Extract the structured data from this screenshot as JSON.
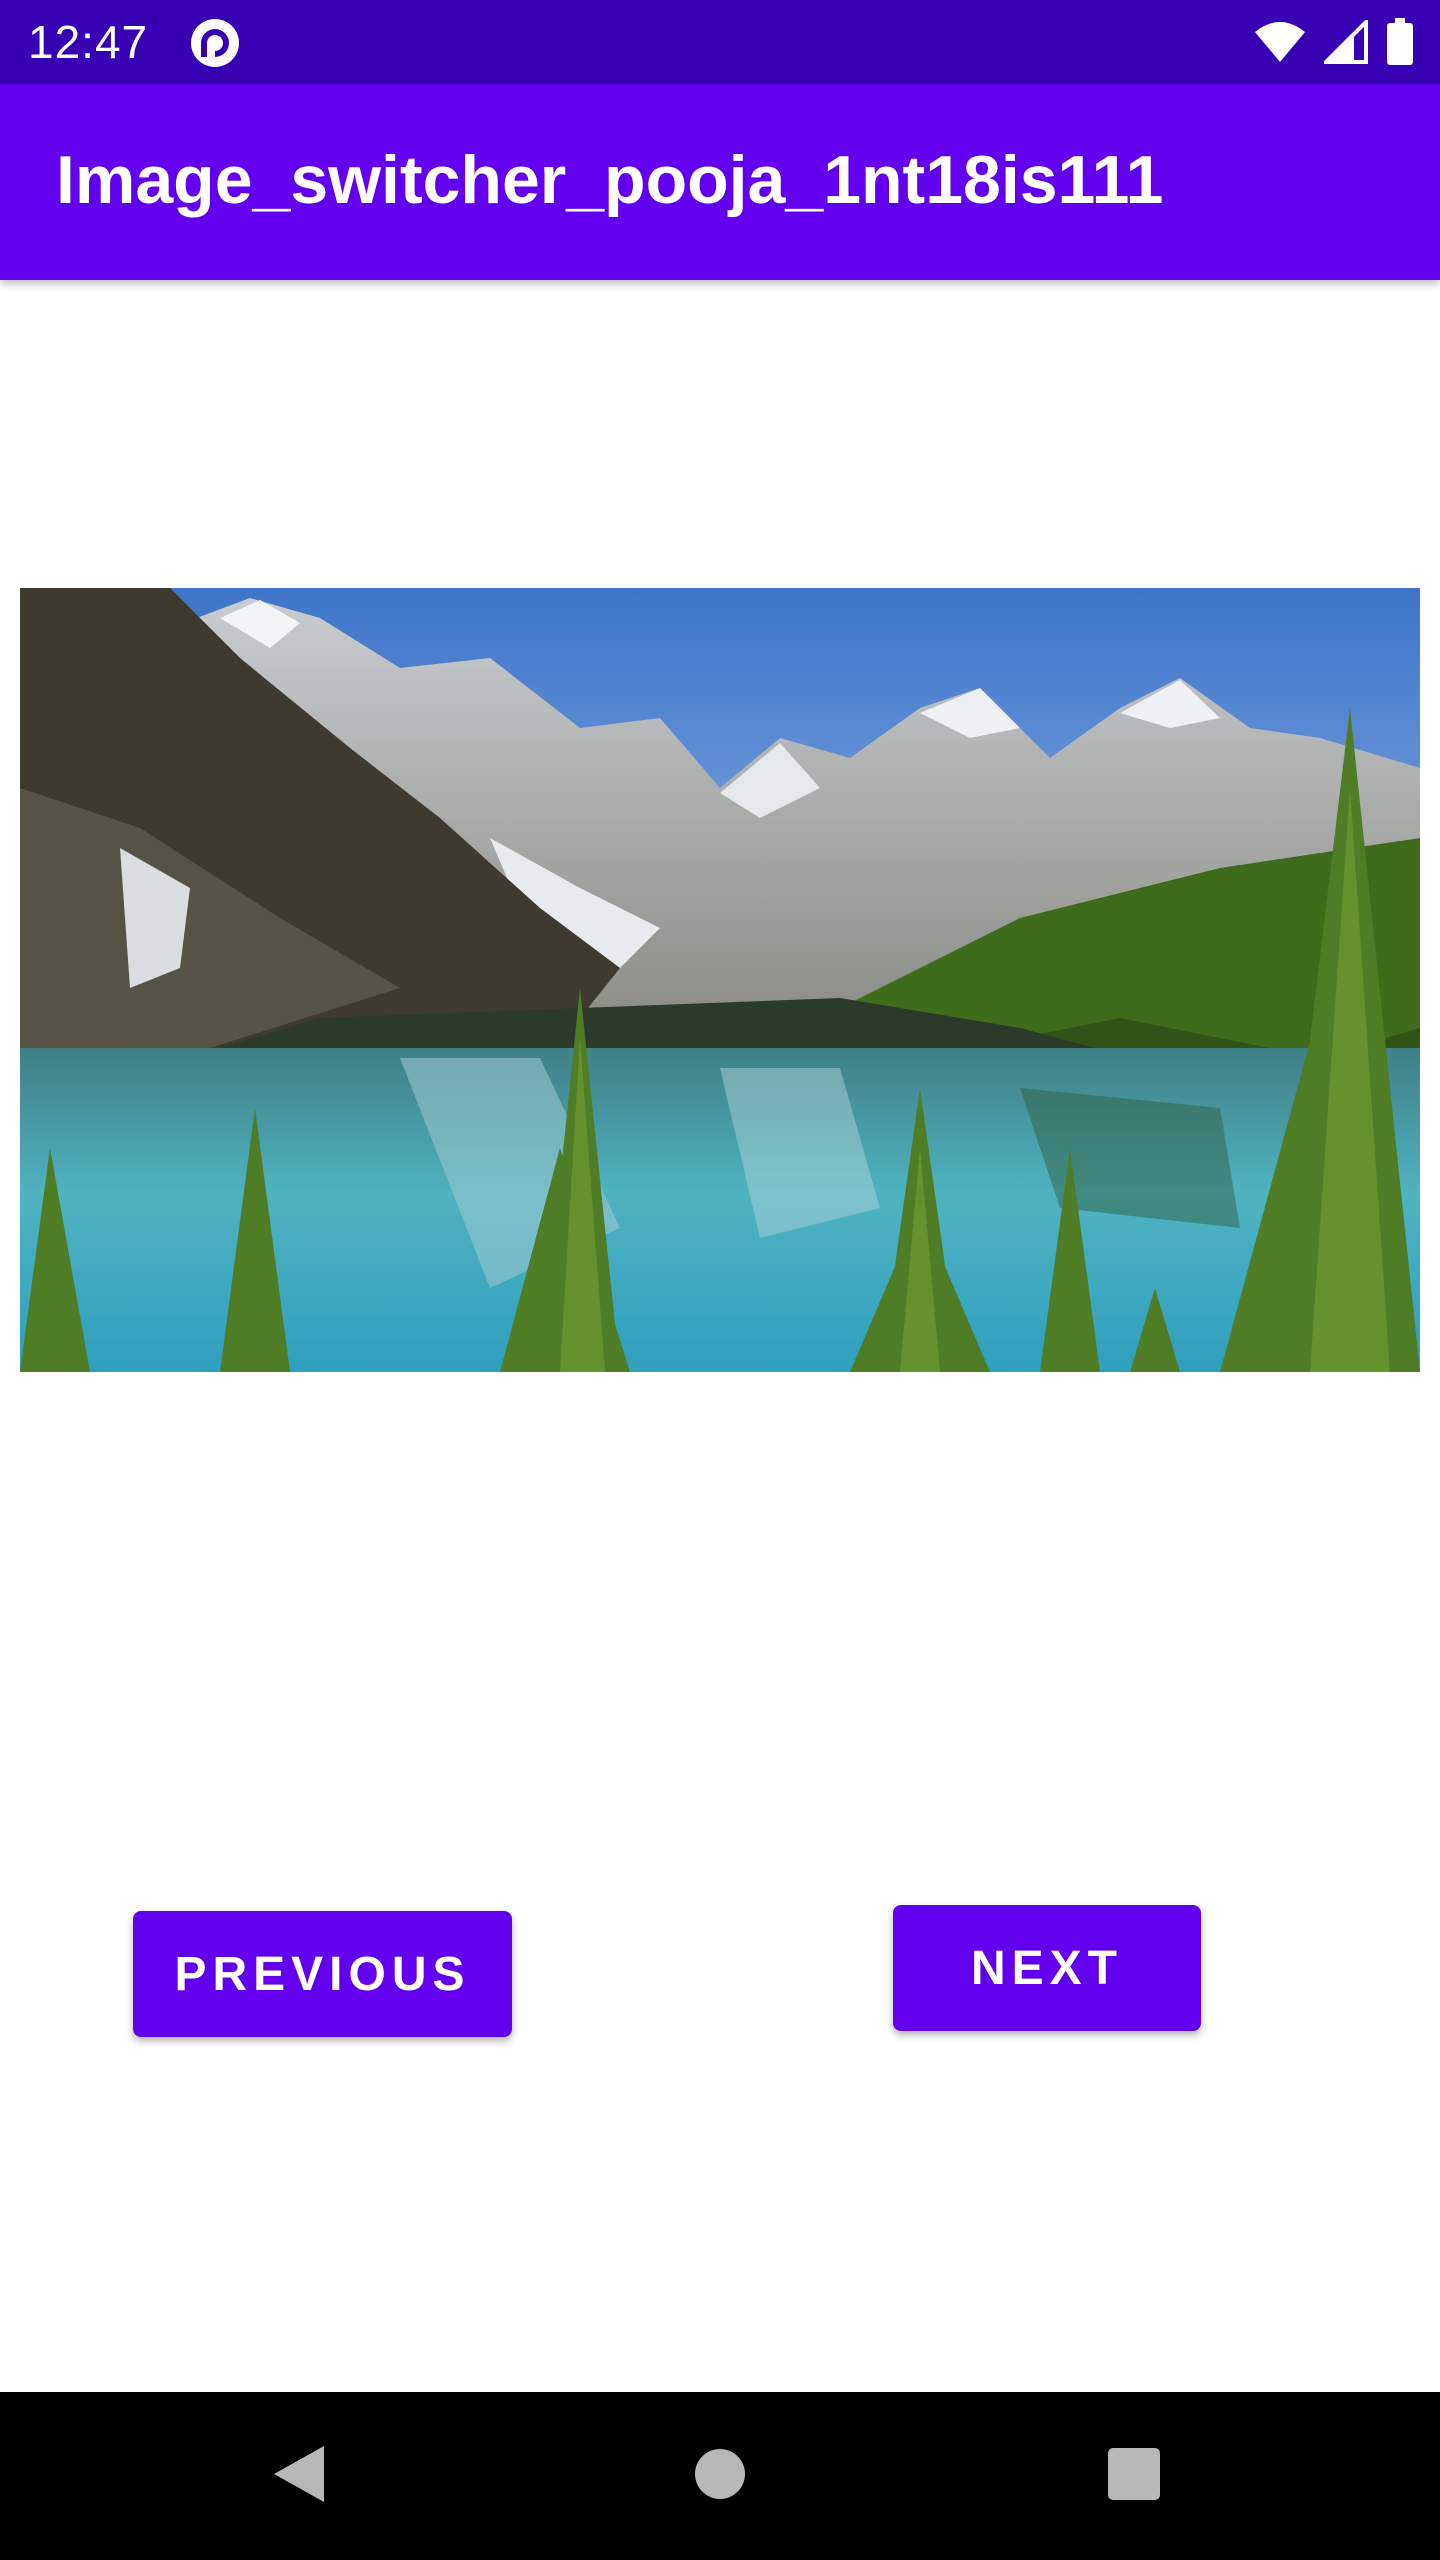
{
  "status_bar": {
    "time": "12:47",
    "app_icon": "pocket-casts-icon",
    "icons": [
      "wifi-icon",
      "cell-signal-icon",
      "battery-icon"
    ],
    "background": "#3700b3"
  },
  "app_bar": {
    "title": "Image_switcher_pooja_1nt18is111",
    "background": "#6200ee"
  },
  "image_switcher": {
    "image": "mountain-lake-landscape"
  },
  "buttons": {
    "previous_label": "PREVIOUS",
    "next_label": "NEXT",
    "color": "#6200ee"
  },
  "nav_bar": {
    "icons": [
      "back-icon",
      "home-icon",
      "recents-icon"
    ]
  }
}
